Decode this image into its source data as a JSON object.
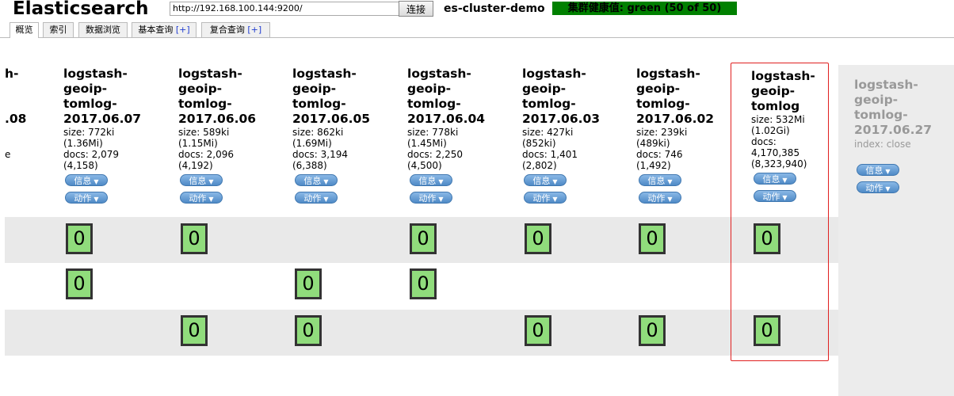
{
  "header": {
    "app_title": "Elasticsearch",
    "url": "http://192.168.100.144:9200/",
    "connect_label": "连接",
    "cluster_name": "es-cluster-demo",
    "health": "集群健康值: green (50 of 50)"
  },
  "tabs": [
    {
      "label": "概览"
    },
    {
      "label": "索引"
    },
    {
      "label": "数据浏览"
    },
    {
      "label": "基本查询",
      "plus": "[+]"
    },
    {
      "label": "复合查询",
      "plus": "[+]"
    }
  ],
  "colors": {
    "health_green": "#008000",
    "shard_green": "#90dc7c",
    "highlight_red": "#e02020",
    "pill_blue": "#4f8ac6"
  },
  "partial_index": {
    "name_top": "h-",
    "name_bottom": ".08",
    "meta_fragment": "e"
  },
  "buttons": {
    "info": "信息",
    "action": "动作"
  },
  "shard_label": "0",
  "indices": [
    {
      "l1": "logstash-",
      "l2": "geoip-",
      "l3": "tomlog-",
      "l4": "2017.06.07",
      "size": "size: 772ki",
      "size2": "(1.36Mi)",
      "docs": "docs: 2,079",
      "docs2": "(4,158)"
    },
    {
      "l1": "logstash-",
      "l2": "geoip-",
      "l3": "tomlog-",
      "l4": "2017.06.06",
      "size": "size: 589ki",
      "size2": "(1.15Mi)",
      "docs": "docs: 2,096",
      "docs2": "(4,192)"
    },
    {
      "l1": "logstash-",
      "l2": "geoip-",
      "l3": "tomlog-",
      "l4": "2017.06.05",
      "size": "size: 862ki",
      "size2": "(1.69Mi)",
      "docs": "docs: 3,194",
      "docs2": "(6,388)"
    },
    {
      "l1": "logstash-",
      "l2": "geoip-",
      "l3": "tomlog-",
      "l4": "2017.06.04",
      "size": "size: 778ki",
      "size2": "(1.45Mi)",
      "docs": "docs: 2,250",
      "docs2": "(4,500)"
    },
    {
      "l1": "logstash-",
      "l2": "geoip-",
      "l3": "tomlog-",
      "l4": "2017.06.03",
      "size": "size: 427ki",
      "size2": "(852ki)",
      "docs": "docs: 1,401",
      "docs2": "(2,802)"
    },
    {
      "l1": "logstash-",
      "l2": "geoip-",
      "l3": "tomlog-",
      "l4": "2017.06.02",
      "size": "size: 239ki",
      "size2": "(489ki)",
      "docs": "docs: 746",
      "docs2": "(1,492)"
    },
    {
      "l1": "logstash-",
      "l2": "geoip-",
      "l3": "tomlog",
      "l4": "",
      "size": "size: 532Mi",
      "size2": "(1.02Gi)",
      "docs": "docs:",
      "docs2": "4,170,385",
      "docs3": "(8,323,940)"
    }
  ],
  "closed_index": {
    "l1": "logstash-",
    "l2": "geoip-",
    "l3": "tomlog-",
    "l4": "2017.06.27",
    "status": "index: close"
  }
}
